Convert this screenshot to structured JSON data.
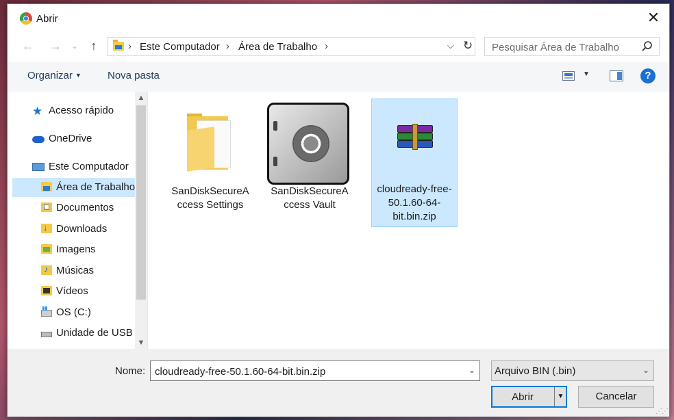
{
  "window": {
    "title": "Abrir",
    "close_glyph": "✕"
  },
  "address": {
    "crumbs": [
      "Este Computador",
      "Área de Trabalho"
    ],
    "separator": "›",
    "dropdown_glyph": "⌵",
    "refresh_glyph": "↻"
  },
  "nav": {
    "back_glyph": "←",
    "forward_glyph": "→",
    "recent_glyph": "⌄",
    "up_glyph": "↑"
  },
  "search": {
    "placeholder": "Pesquisar Área de Trabalho"
  },
  "toolbar": {
    "organize_label": "Organizar",
    "new_folder_label": "Nova pasta",
    "help_glyph": "?"
  },
  "sidebar": {
    "items": [
      {
        "label": "Acesso rápido",
        "icon": "star-icon"
      },
      {
        "label": "OneDrive",
        "icon": "cloud-icon"
      },
      {
        "label": "Este Computador",
        "icon": "computer-icon"
      },
      {
        "label": "Área de Trabalho",
        "icon": "desktop-folder-icon",
        "selected": true
      },
      {
        "label": "Documentos",
        "icon": "documents-folder-icon"
      },
      {
        "label": "Downloads",
        "icon": "downloads-folder-icon"
      },
      {
        "label": "Imagens",
        "icon": "pictures-folder-icon"
      },
      {
        "label": "Músicas",
        "icon": "music-folder-icon"
      },
      {
        "label": "Vídeos",
        "icon": "videos-folder-icon"
      },
      {
        "label": "OS (C:)",
        "icon": "drive-icon"
      },
      {
        "label": "Unidade de USB",
        "icon": "usb-drive-icon"
      }
    ]
  },
  "files": [
    {
      "name": "SanDiskSecureAccess Settings",
      "icon": "folder-icon"
    },
    {
      "name": "SanDiskSecureAccess Vault",
      "icon": "vault-icon"
    },
    {
      "name": "cloudready-free-50.1.60-64-bit.bin.zip",
      "icon": "winrar-archive-icon",
      "selected": true
    }
  ],
  "footer": {
    "name_label": "Nome:",
    "name_value": "cloudready-free-50.1.60-64-bit.bin.zip",
    "file_type": "Arquivo BIN (.bin)",
    "open_label": "Abrir",
    "cancel_label": "Cancelar",
    "dropdown_glyph": "⌄"
  }
}
